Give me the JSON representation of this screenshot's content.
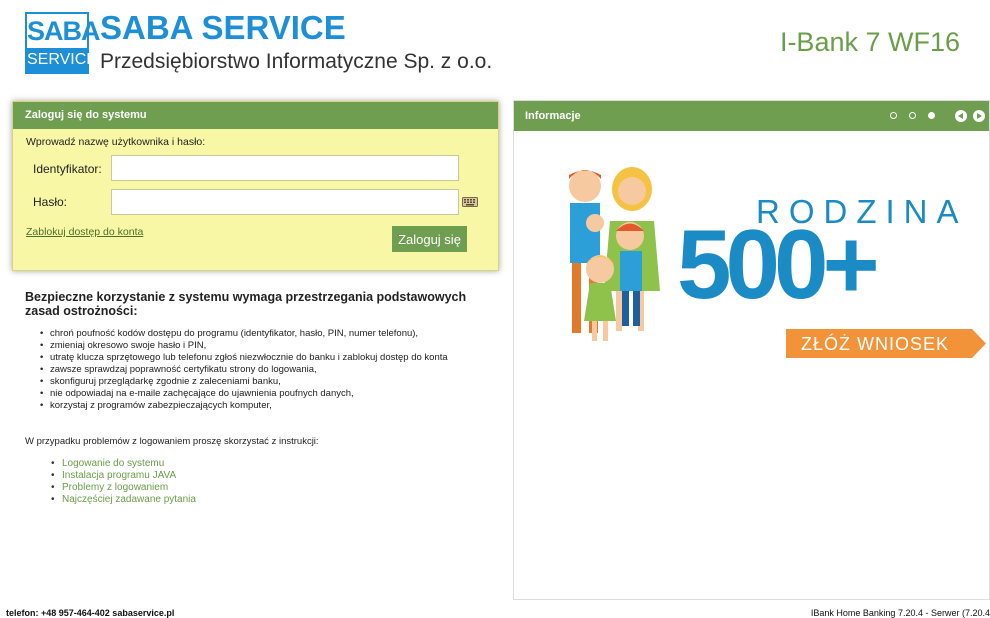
{
  "header": {
    "logo_top": "SABA",
    "logo_bottom": "SERVICE",
    "company_name": "SABA SERVICE",
    "company_sub": "Przedsiębiorstwo Informatyczne Sp. z o.o.",
    "app_title": "I-Bank 7 WF16",
    "brand_color": "#1d8fd6",
    "accent_color": "#6f9e50"
  },
  "login": {
    "panel_title": "Zaloguj się do systemu",
    "intro": "Wprowadź nazwę użytkownika i hasło:",
    "id_label": "Identyfikator:",
    "id_value": "",
    "password_label": "Hasło:",
    "password_value": "",
    "keyboard_icon": "keyboard-icon",
    "lock_link": "Zablokuj dostęp do konta",
    "submit_label": "Zaloguj się"
  },
  "security": {
    "title": "Bezpieczne korzystanie z systemu wymaga przestrzegania podstawowych zasad ostrożności:",
    "items": [
      "chroń poufność kodów dostępu do programu (identyfikator, hasło, PIN, numer telefonu),",
      "zmieniaj okresowo swoje hasło i PIN,",
      "utratę klucza sprzętowego lub telefonu zgłoś niezwłocznie do banku i zablokuj dostęp do konta",
      "zawsze sprawdzaj poprawność certyfikatu strony do logowania,",
      "skonfiguruj przeglądarkę zgodnie z zaleceniami banku,",
      "nie odpowiadaj na e-maile zachęcające do ujawnienia poufnych danych,",
      "korzystaj z programów zabezpieczających komputer,"
    ],
    "help_intro": "W przypadku problemów z logowaniem proszę skorzystać z instrukcji:",
    "help_links": [
      "Logowanie do systemu",
      "Instalacja programu JAVA",
      "Problemy z logowaniem",
      "Najczęściej zadawane pytania"
    ]
  },
  "info": {
    "panel_title": "Informacje",
    "slide_count": 3,
    "active_slide": 3,
    "promo_word": "RODZINA",
    "promo_number": "500+",
    "promo_button": "ZŁÓŻ WNIOSEK",
    "promo_blue": "#1a8bc4",
    "promo_orange": "#f2933a"
  },
  "footer": {
    "left": "telefon: +48 957-464-402 sabaservice.pl",
    "right": "IBank Home Banking 7.20.4 - Serwer (7.20.4"
  }
}
